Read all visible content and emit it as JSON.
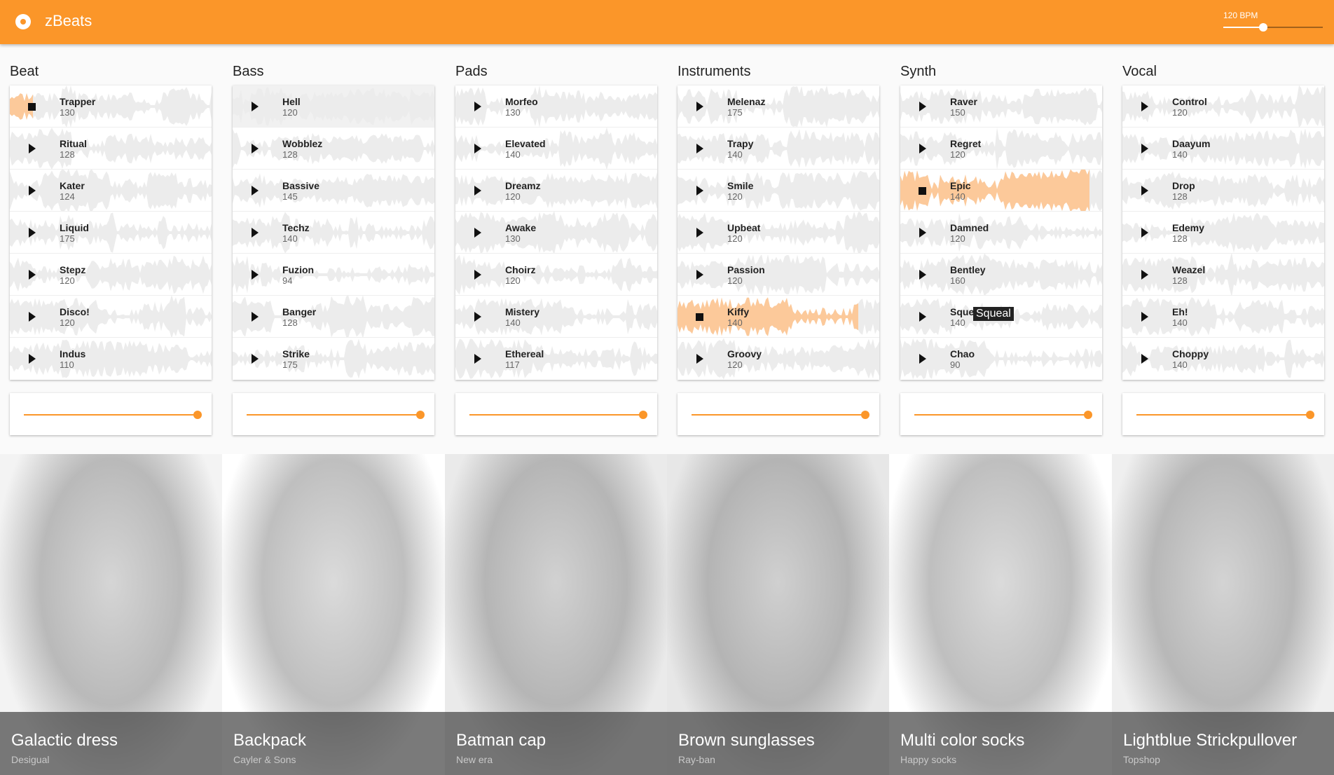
{
  "app": {
    "title": "zBeats",
    "bpm_label": "120 BPM",
    "bpm_value": 120,
    "bpm_fraction": 0.4,
    "accent": "#fb9629",
    "header_bg": "#fb9629"
  },
  "columns": [
    {
      "title": "Beat",
      "volume": 1.0,
      "tracks": [
        {
          "name": "Trapper",
          "bpm": "130",
          "state": "playing",
          "progress": 0.12
        },
        {
          "name": "Ritual",
          "bpm": "128"
        },
        {
          "name": "Kater",
          "bpm": "124"
        },
        {
          "name": "Liquid",
          "bpm": "175"
        },
        {
          "name": "Stepz",
          "bpm": "120"
        },
        {
          "name": "Disco!",
          "bpm": "120"
        },
        {
          "name": "Indus",
          "bpm": "110"
        }
      ]
    },
    {
      "title": "Bass",
      "volume": 1.0,
      "tracks": [
        {
          "name": "Hell",
          "bpm": "120",
          "highlighted": true
        },
        {
          "name": "Wobblez",
          "bpm": "128"
        },
        {
          "name": "Bassive",
          "bpm": "145"
        },
        {
          "name": "Techz",
          "bpm": "140"
        },
        {
          "name": "Fuzion",
          "bpm": "94"
        },
        {
          "name": "Banger",
          "bpm": "128"
        },
        {
          "name": "Strike",
          "bpm": "175"
        }
      ]
    },
    {
      "title": "Pads",
      "volume": 1.0,
      "tracks": [
        {
          "name": "Morfeo",
          "bpm": "130"
        },
        {
          "name": "Elevated",
          "bpm": "140"
        },
        {
          "name": "Dreamz",
          "bpm": "120"
        },
        {
          "name": "Awake",
          "bpm": "130"
        },
        {
          "name": "Choirz",
          "bpm": "120"
        },
        {
          "name": "Mistery",
          "bpm": "140"
        },
        {
          "name": "Ethereal",
          "bpm": "117"
        }
      ]
    },
    {
      "title": "Instruments",
      "volume": 1.0,
      "tracks": [
        {
          "name": "Melenaz",
          "bpm": "175"
        },
        {
          "name": "Trapy",
          "bpm": "140"
        },
        {
          "name": "Smile",
          "bpm": "120"
        },
        {
          "name": "Upbeat",
          "bpm": "120"
        },
        {
          "name": "Passion",
          "bpm": "120"
        },
        {
          "name": "Kiffy",
          "bpm": "140",
          "state": "playing",
          "progress": 0.9
        },
        {
          "name": "Groovy",
          "bpm": "120"
        }
      ]
    },
    {
      "title": "Synth",
      "volume": 1.0,
      "tracks": [
        {
          "name": "Raver",
          "bpm": "150"
        },
        {
          "name": "Regret",
          "bpm": "120"
        },
        {
          "name": "Epic",
          "bpm": "140",
          "state": "playing",
          "progress": 0.94
        },
        {
          "name": "Damned",
          "bpm": "120"
        },
        {
          "name": "Bentley",
          "bpm": "160"
        },
        {
          "name": "Squeal",
          "bpm": "140",
          "tooltip": "Squeal"
        },
        {
          "name": "Chao",
          "bpm": "90"
        }
      ]
    },
    {
      "title": "Vocal",
      "volume": 1.0,
      "tracks": [
        {
          "name": "Control",
          "bpm": "120"
        },
        {
          "name": "Daayum",
          "bpm": "140"
        },
        {
          "name": "Drop",
          "bpm": "128"
        },
        {
          "name": "Edemy",
          "bpm": "128"
        },
        {
          "name": "Weazel",
          "bpm": "128"
        },
        {
          "name": "Eh!",
          "bpm": "140"
        },
        {
          "name": "Choppy",
          "bpm": "140"
        }
      ]
    }
  ],
  "products": [
    {
      "name": "Galactic dress",
      "brand": "Desigual",
      "bg": "#f3f3f3"
    },
    {
      "name": "Backpack",
      "brand": "Cayler & Sons",
      "bg": "#ffffff"
    },
    {
      "name": "Batman cap",
      "brand": "New era",
      "bg": "#eaeaea"
    },
    {
      "name": "Brown sunglasses",
      "brand": "Ray-ban",
      "bg": "#e7e7e7"
    },
    {
      "name": "Multi color socks",
      "brand": "Happy socks",
      "bg": "#ffffff"
    },
    {
      "name": "Lightblue Strickpullover",
      "brand": "Topshop",
      "bg": "#efefef"
    }
  ]
}
